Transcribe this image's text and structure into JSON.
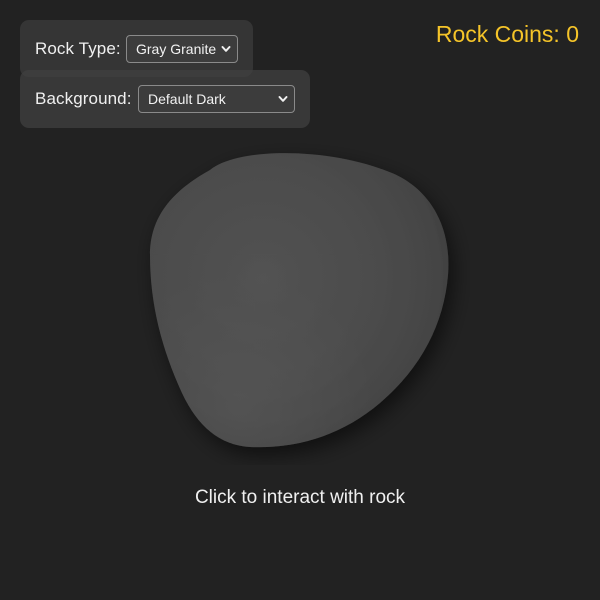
{
  "controls": {
    "rock_type": {
      "label": "Rock Type:",
      "selected": "Gray Granite"
    },
    "background": {
      "label": "Background:",
      "selected": "Default Dark"
    }
  },
  "coins": {
    "text": "Rock Coins: 0"
  },
  "hint": {
    "text": "Click to interact with rock"
  },
  "icons": {
    "dropdown": "chevron-down-icon"
  },
  "colors": {
    "page_background": "#222222",
    "coins_text": "#f5c429",
    "rock_base": "#4d4d4d"
  }
}
